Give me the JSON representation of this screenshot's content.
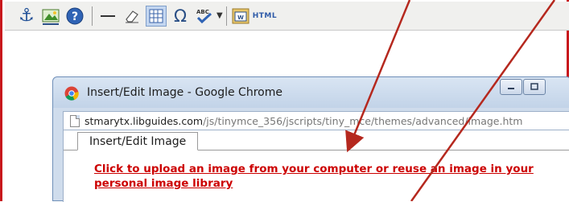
{
  "toolbar": {
    "buttons": [
      {
        "name": "anchor",
        "icon": "anchor-icon"
      },
      {
        "name": "image",
        "icon": "image-icon"
      },
      {
        "name": "help",
        "icon": "help-icon"
      },
      {
        "name": "horizontal-rule",
        "icon": "horizontal-rule-icon"
      },
      {
        "name": "cleanup",
        "icon": "eraser-icon"
      },
      {
        "name": "visual-aid",
        "icon": "table-grid-icon",
        "selected": true
      },
      {
        "name": "special-character",
        "icon": "omega-icon"
      },
      {
        "name": "spellcheck",
        "icon": "spellcheck-icon"
      },
      {
        "name": "html",
        "icon": "html-icon",
        "label": "HTML"
      }
    ]
  },
  "popup": {
    "window_title": "Insert/Edit Image - Google Chrome",
    "url_host": "stmarytx.libguides.com",
    "url_path": "/js/tinymce_356/jscripts/tiny_mce/themes/advanced/image.htm",
    "tab_label": "Insert/Edit Image",
    "upload_link": "Click to upload an image from your computer or reuse an image in your personal image library"
  },
  "colors": {
    "annotation_arrow": "#b5281e",
    "border_accent": "#c8181c",
    "link_red": "#cc0000"
  }
}
